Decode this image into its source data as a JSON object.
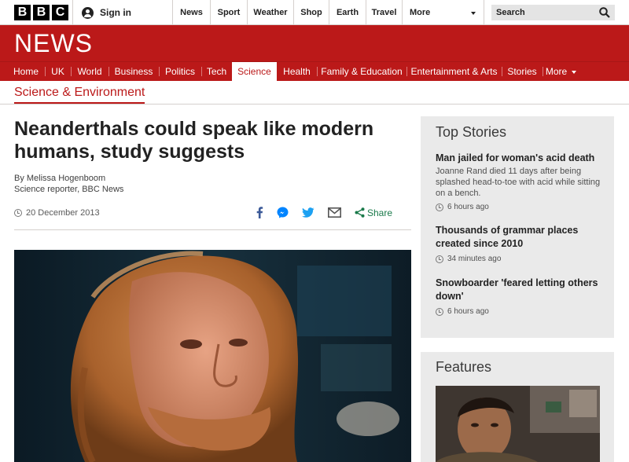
{
  "masthead": {
    "logo_letters": [
      "B",
      "B",
      "C"
    ],
    "signin_label": "Sign in",
    "top_nav": [
      {
        "label": "News"
      },
      {
        "label": "Sport"
      },
      {
        "label": "Weather"
      },
      {
        "label": "Shop"
      },
      {
        "label": "Earth"
      },
      {
        "label": "Travel"
      }
    ],
    "more_label": "More",
    "search_placeholder": "Search"
  },
  "banner": {
    "title": "NEWS",
    "nav": [
      {
        "label": "Home"
      },
      {
        "label": "UK"
      },
      {
        "label": "World"
      },
      {
        "label": "Business"
      },
      {
        "label": "Politics"
      },
      {
        "label": "Tech"
      },
      {
        "label": "Science",
        "active": true
      },
      {
        "label": "Health"
      },
      {
        "label": "Family & Education"
      },
      {
        "label": "Entertainment & Arts"
      },
      {
        "label": "Stories"
      },
      {
        "label": "More"
      }
    ]
  },
  "section_label": "Science & Environment",
  "article": {
    "headline": "Neanderthals could speak like modern humans, study suggests",
    "author": "By Melissa Hogenboom",
    "author_role": "Science reporter, BBC News",
    "date": "20 December 2013",
    "share_label": "Share"
  },
  "top_stories": {
    "title": "Top Stories",
    "items": [
      {
        "headline": "Man jailed for woman's acid death",
        "summary": "Joanne Rand died 11 days after being splashed head-to-toe with acid while sitting on a bench.",
        "time": "6 hours ago"
      },
      {
        "headline": "Thousands of grammar places created since 2010",
        "summary": "",
        "time": "34 minutes ago"
      },
      {
        "headline": "Snowboarder 'feared letting others down'",
        "summary": "",
        "time": "6 hours ago"
      }
    ]
  },
  "features": {
    "title": "Features"
  },
  "colors": {
    "brand_red": "#bb1919",
    "sidebar_grey": "#eaeaea",
    "share_green": "#1a7a4a",
    "facebook_blue": "#3b5998",
    "twitter_blue": "#1da1f2",
    "messenger_blue": "#0084ff"
  }
}
